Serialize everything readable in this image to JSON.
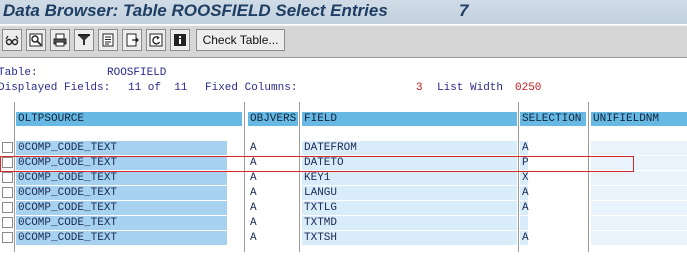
{
  "window": {
    "title": "Data Browser: Table ROOSFIELD Select Entries",
    "entry_count": "7"
  },
  "toolbar": {
    "icons": [
      "glasses-icon",
      "magnifier-icon",
      "print-icon",
      "filter-icon",
      "sum-icon",
      "export-icon",
      "refresh-icon",
      "info-icon"
    ],
    "check_table_label": "Check Table..."
  },
  "info": {
    "table_label": "Table:",
    "table_value": "ROOSFIELD",
    "displayed_label": "Displayed Fields:",
    "displayed_value": "11 of  11",
    "fixed_label": "Fixed Columns:",
    "fixed_value": "3",
    "width_label": "List Width",
    "width_value": "0250"
  },
  "table": {
    "headers": {
      "oltpsource": "OLTPSOURCE",
      "objvers": "OBJVERS",
      "field": "FIELD",
      "selection": "SELECTION",
      "unifieldnm": "UNIFIELDNM"
    },
    "rows": [
      {
        "oltpsource": "0COMP_CODE_TEXT",
        "objvers": "A",
        "field": "DATEFROM",
        "selection": "A",
        "unifieldnm": ""
      },
      {
        "oltpsource": "0COMP_CODE_TEXT",
        "objvers": "A",
        "field": "DATETO",
        "selection": "P",
        "unifieldnm": ""
      },
      {
        "oltpsource": "0COMP_CODE_TEXT",
        "objvers": "A",
        "field": "KEY1",
        "selection": "X",
        "unifieldnm": ""
      },
      {
        "oltpsource": "0COMP_CODE_TEXT",
        "objvers": "A",
        "field": "LANGU",
        "selection": "A",
        "unifieldnm": ""
      },
      {
        "oltpsource": "0COMP_CODE_TEXT",
        "objvers": "A",
        "field": "TXTLG",
        "selection": "A",
        "unifieldnm": ""
      },
      {
        "oltpsource": "0COMP_CODE_TEXT",
        "objvers": "A",
        "field": "TXTMD",
        "selection": "",
        "unifieldnm": ""
      },
      {
        "oltpsource": "0COMP_CODE_TEXT",
        "objvers": "A",
        "field": "TXTSH",
        "selection": "A",
        "unifieldnm": ""
      }
    ]
  },
  "colors": {
    "header_blue": "#67b8e3",
    "key_cell": "#a6d2ef",
    "highlight": "#d62a2a"
  }
}
